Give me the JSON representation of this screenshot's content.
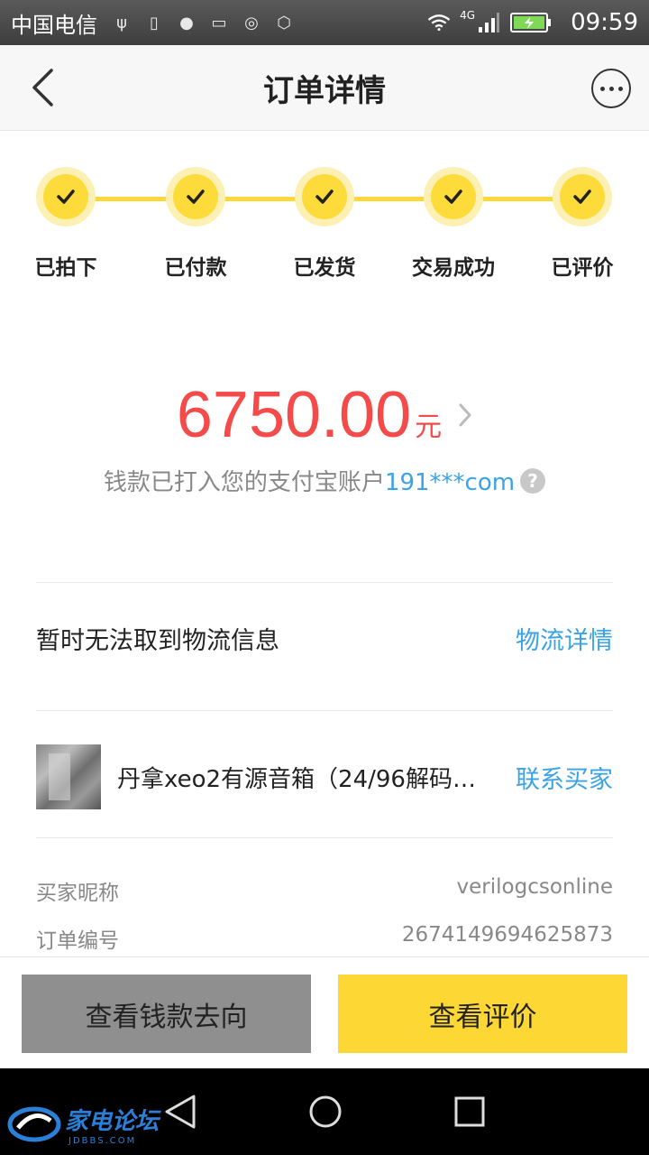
{
  "status_bar": {
    "carrier": "中国电信",
    "network": "4G",
    "time": "09:59"
  },
  "header": {
    "title": "订单详情"
  },
  "steps": [
    {
      "label": "已拍下"
    },
    {
      "label": "已付款"
    },
    {
      "label": "已发货"
    },
    {
      "label": "交易成功"
    },
    {
      "label": "已评价"
    }
  ],
  "payment": {
    "amount": "6750.00",
    "unit": "元",
    "info_prefix": "钱款已打入您的支付宝账户",
    "account": "191***com",
    "help": "?"
  },
  "logistics": {
    "message": "暂时无法取到物流信息",
    "link": "物流详情"
  },
  "product": {
    "name": "丹拿xeo2有源音箱（24/96解码…",
    "contact_link": "联系买家"
  },
  "order_info": [
    {
      "label": "买家昵称",
      "value": "verilogcsonline"
    },
    {
      "label": "订单编号",
      "value": "2674149694625873"
    }
  ],
  "actions": {
    "left_button": "查看钱款去向",
    "right_button": "查看评价"
  },
  "watermark": {
    "text": "家电论坛",
    "sub": "JDBBS.COM"
  },
  "colors": {
    "accent_yellow": "#fdd835",
    "amount_red": "#f44a4a",
    "link_blue": "#3aa3e8"
  }
}
